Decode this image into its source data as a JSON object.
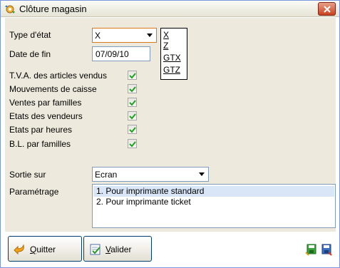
{
  "window": {
    "title": "Clôture magasin",
    "icon": "gear-arrows-icon",
    "close_icon": "close-icon"
  },
  "form": {
    "type_etat": {
      "label": "Type d'état",
      "value": "X",
      "options": [
        "X",
        "Z",
        "GTX",
        "GTZ"
      ]
    },
    "date_fin": {
      "label": "Date de fin",
      "value": "07/09/10"
    },
    "checkboxes": [
      {
        "label": "T.V.A. des articles vendus",
        "checked": true
      },
      {
        "label": "Mouvements de caisse",
        "checked": true
      },
      {
        "label": "Ventes par familles",
        "checked": true
      },
      {
        "label": "Etats des vendeurs",
        "checked": true
      },
      {
        "label": "Etats par heures",
        "checked": true
      },
      {
        "label": "B.L. par familles",
        "checked": true
      }
    ],
    "sortie": {
      "label": "Sortie sur",
      "value": "Ecran"
    },
    "parametrage": {
      "label": "Paramétrage",
      "items": [
        "1. Pour imprimante standard",
        "2. Pour imprimante ticket"
      ],
      "selected_index": 0
    }
  },
  "buttons": {
    "quitter": {
      "label_first": "Q",
      "label_rest": "uitter",
      "icon": "back-arrow-icon"
    },
    "valider": {
      "label_first": "V",
      "label_rest": "alider",
      "icon": "validate-icon"
    }
  },
  "colors": {
    "panel_bg": "#ede9dc",
    "selection_bg": "#d8e6f7",
    "close_red": "#c7411d"
  }
}
